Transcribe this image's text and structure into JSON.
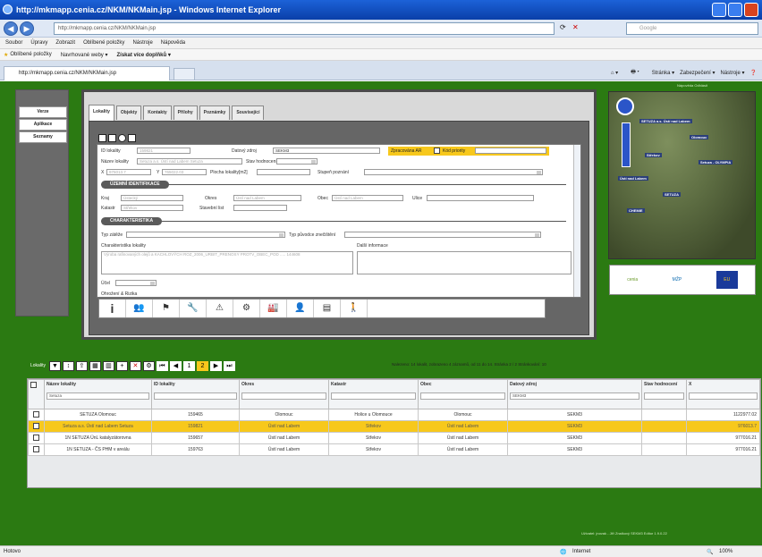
{
  "window": {
    "title": "http://mkmapp.cenia.cz/NKM/NKMain.jsp - Windows Internet Explorer"
  },
  "address": {
    "url": "http://mkmapp.cenia.cz/NKM/NKMain.jsp",
    "search_placeholder": "Google"
  },
  "menu": [
    "Soubor",
    "Úpravy",
    "Zobrazit",
    "Oblíbené položky",
    "Nástroje",
    "Nápověda"
  ],
  "favorites": {
    "label": "Oblíbené položky",
    "items": [
      "Navrhované weby ▾",
      "Získat více doplňků ▾"
    ]
  },
  "tab": {
    "label": "http://mkmapp.cenia.cz/NKM/NKMain.jsp"
  },
  "commandbar": [
    "Stránka ▾",
    "Zabezpečení ▾",
    "Nástroje ▾"
  ],
  "left_nav": [
    "Verze",
    "Aplikace",
    "Seznamy"
  ],
  "top_links": "Nápověda   Odhlásit",
  "tabs": [
    "Lokality",
    "Objekty",
    "Kontakty",
    "Přílohy",
    "Poznámky",
    "Související"
  ],
  "form": {
    "id_label": "ID lokality",
    "id_value": "159821",
    "source_label": "Datový zdroj",
    "source_value": "SEKM3",
    "processed_label": "Zpracována AR",
    "priority_label": "Kód priority",
    "name_label": "Název lokality",
    "name_value": "Setuza a.s. Ústí nad Labem Setuza",
    "state_label": "Stav hodnocení",
    "x_label": "X",
    "x_value": "976013.7",
    "y_label": "Y",
    "y_value": "765022.03",
    "area_label": "Plocha lokality[m2]",
    "contam_label": "Stupeň poznání",
    "sec_uzemni": "ÚZEMNÍ IDENTIFIKACE",
    "kraj_label": "Kraj",
    "kraj_value": "Ústecký",
    "okres_label": "Okres",
    "okres_value": "Ústí nad Labem",
    "obec_label": "Obec",
    "obec_value": "Ústí nad Labem",
    "ulice_label": "Ulice",
    "katastr_label": "Katastr",
    "katastr_value": "Střekov",
    "stav_label": "Stavební list",
    "sec_char": "CHARAKTERISTIKA",
    "typ_label": "Typ zátěže",
    "puvod_label": "Typ původce znečištění",
    "charakt_label": "Charakteristika lokality",
    "dalsi_label": "Další informace",
    "charakt_value": "Výroba rafinovaných olejů a KACHLOVÝCH ROZ_2006_URBIT_PRENOSY PROTV_OBEC_POD ..... 144608",
    "ucel_label": "Účel",
    "ohrozeni_label": "Ohrožení & Rizika"
  },
  "bottom_icons": [
    "i",
    "👥",
    "⚑",
    "🔧",
    "⚠",
    "⚙",
    "🏭",
    "👤",
    "▤",
    "🚶"
  ],
  "map_labels": [
    "SETUZA a.s. Ústí nad Labem",
    "Olomouc",
    "Střekov",
    "Setuza - OLYMPIA",
    "Ústí nad Labem",
    "SETUZA",
    "CHEMIE"
  ],
  "logos": [
    "cenia",
    "MŽP",
    "EU"
  ],
  "grid": {
    "label": "Lokality",
    "pageinfo": "Nalezeno: 14 lokalit, zobrazeno 4 záznamů, od 11 do 14. Stránka 2 / 2   Stránkování: 10",
    "pages": [
      "1",
      "2"
    ],
    "columns": [
      "Název lokality",
      "ID lokality",
      "Okres",
      "Katastr",
      "Obec",
      "Datový zdroj",
      "Stav hodnocení",
      "X"
    ],
    "filters": [
      "Setuza",
      "",
      "",
      "",
      "",
      "SEKM3",
      "",
      ""
    ],
    "rows": [
      [
        "SETUZA Olomouc",
        "159465",
        "Olomouc",
        "Holice u Olomouce",
        "Olomouc",
        "SEKM3",
        "",
        "1122977.02"
      ],
      [
        "Setuza a.s. Ústí nad Labem Setuza",
        "159821",
        "Ústí nad Labem",
        "Střekov",
        "Ústí nad Labem",
        "SEKM3",
        "",
        "976013.7"
      ],
      [
        "1N SETUZA ÚnL katalyzátorovna",
        "159657",
        "Ústí nad Labem",
        "Střekov",
        "Ústí nad Labem",
        "SEKM3",
        "",
        "977016.21"
      ],
      [
        "1N SETUZA - ČS PHM v areálu",
        "159763",
        "Ústí nad Labem",
        "Střekov",
        "Ústí nad Labem",
        "SEKM3",
        "",
        "977016.21"
      ]
    ]
  },
  "footnote": "Uživatel: jnovak - Jiří Znalkový SEKM3 Editor 1.9.0.22",
  "status": {
    "left": "Hotovo",
    "zone": "Internet",
    "zoom": "100%"
  }
}
